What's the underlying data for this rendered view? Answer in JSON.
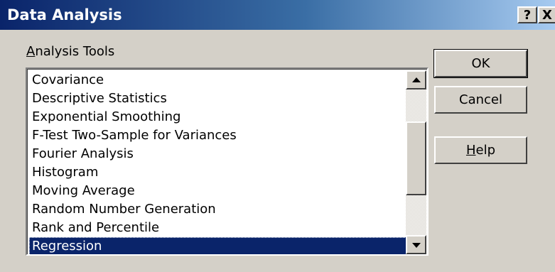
{
  "window": {
    "title": "Data Analysis",
    "help_glyph": "?",
    "close_glyph": "X"
  },
  "analysis_tools": {
    "label_first": "A",
    "label_rest": "nalysis Tools",
    "items": [
      "Covariance",
      "Descriptive Statistics",
      "Exponential Smoothing",
      "F-Test Two-Sample for Variances",
      "Fourier Analysis",
      "Histogram",
      "Moving Average",
      "Random Number Generation",
      "Rank and Percentile",
      "Regression"
    ],
    "selected": "Regression"
  },
  "buttons": {
    "ok": "OK",
    "cancel": "Cancel",
    "help_first": "H",
    "help_rest": "elp"
  },
  "colors": {
    "face": "#d4d0c8",
    "title_start": "#0a246a",
    "title_end": "#a6caf0",
    "selection": "#0a246a"
  }
}
